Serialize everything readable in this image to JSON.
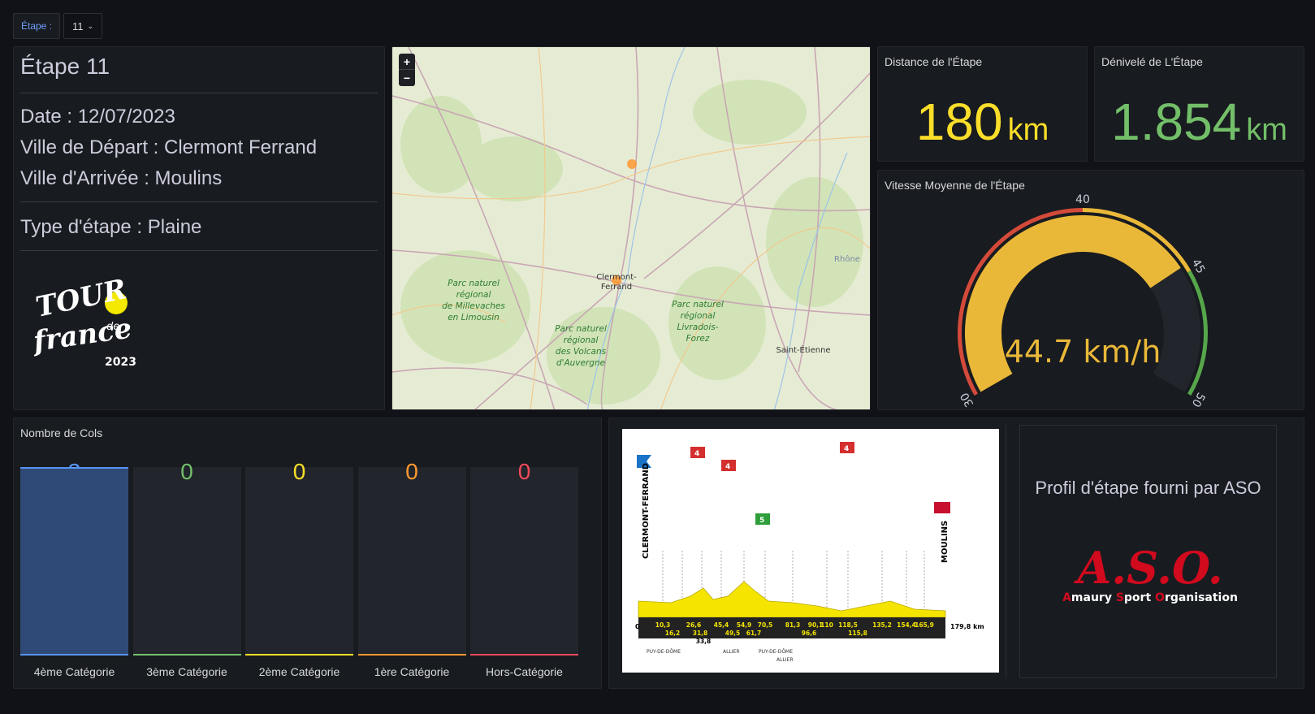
{
  "variable": {
    "label": "Étape :",
    "value": "11"
  },
  "info": {
    "title": "Étape 11",
    "date": "Date : 12/07/2023",
    "start": "Ville de Départ : Clermont Ferrand",
    "end": "Ville d'Arrivée : Moulins",
    "type": "Type d'étape : Plaine",
    "logo_text": [
      "TOUR",
      "de",
      "france",
      "2023"
    ]
  },
  "map": {
    "zoom_in": "+",
    "zoom_out": "−",
    "labels": [
      "Parc naturel régional de Millevaches en Limousin",
      "Clermont-Ferrand",
      "Parc naturel régional des Volcans d'Auvergne",
      "Parc naturel régional Livradois-Forez",
      "Saint-Étienne",
      "Rhône"
    ]
  },
  "distance": {
    "title": "Distance de l'Étape",
    "value": "180",
    "unit": "km",
    "color": "#fade2a"
  },
  "denivele": {
    "title": "Dénivelé de L'Étape",
    "value": "1.854",
    "unit": "km",
    "color": "#73bf69"
  },
  "speed": {
    "title": "Vitesse Moyenne de l'Étape",
    "value": 44.7,
    "display": "44.7 km/h",
    "min": 30,
    "max": 50,
    "ticks": [
      "30",
      "40",
      "45",
      "50"
    ],
    "color": "#eab839"
  },
  "cols": {
    "title": "Nombre de Cols",
    "items": [
      {
        "value": "3",
        "label": "4ème Catégorie",
        "color": "#5794f2"
      },
      {
        "value": "0",
        "label": "3ème Catégorie",
        "color": "#73bf69"
      },
      {
        "value": "0",
        "label": "2ème Catégorie",
        "color": "#fade2a"
      },
      {
        "value": "0",
        "label": "1ère Catégorie",
        "color": "#ff9830"
      },
      {
        "value": "0",
        "label": "Hors-Catégorie",
        "color": "#f2495c"
      }
    ]
  },
  "profile": {
    "aso_text": "Profil d'étape fourni par ASO",
    "aso_logo": "A.S.O.",
    "aso_tag_words": [
      "A",
      "maury ",
      "S",
      "port ",
      "O",
      "rganisation"
    ],
    "start_city": "CLERMONT-FERRAND",
    "end_city": "MOULINS",
    "total": "179,8 km",
    "km_top": [
      "10,3",
      "26,6",
      "45,4",
      "54,9",
      "70,5",
      "81,3",
      "90,1",
      "110",
      "118,5",
      "135,2",
      "154,4",
      "165,9"
    ],
    "km_bottom": [
      "16,2",
      "31,8",
      "49,5",
      "61,7",
      "96,6",
      "115,8"
    ],
    "km_extra": "33,8",
    "zero": "0",
    "depts": [
      "PUY-DE-DÔME",
      "ALLIER",
      "PUY-DE-DÔME",
      "ALLIER"
    ],
    "cat_flags": [
      "4",
      "4",
      "5",
      "4"
    ]
  }
}
